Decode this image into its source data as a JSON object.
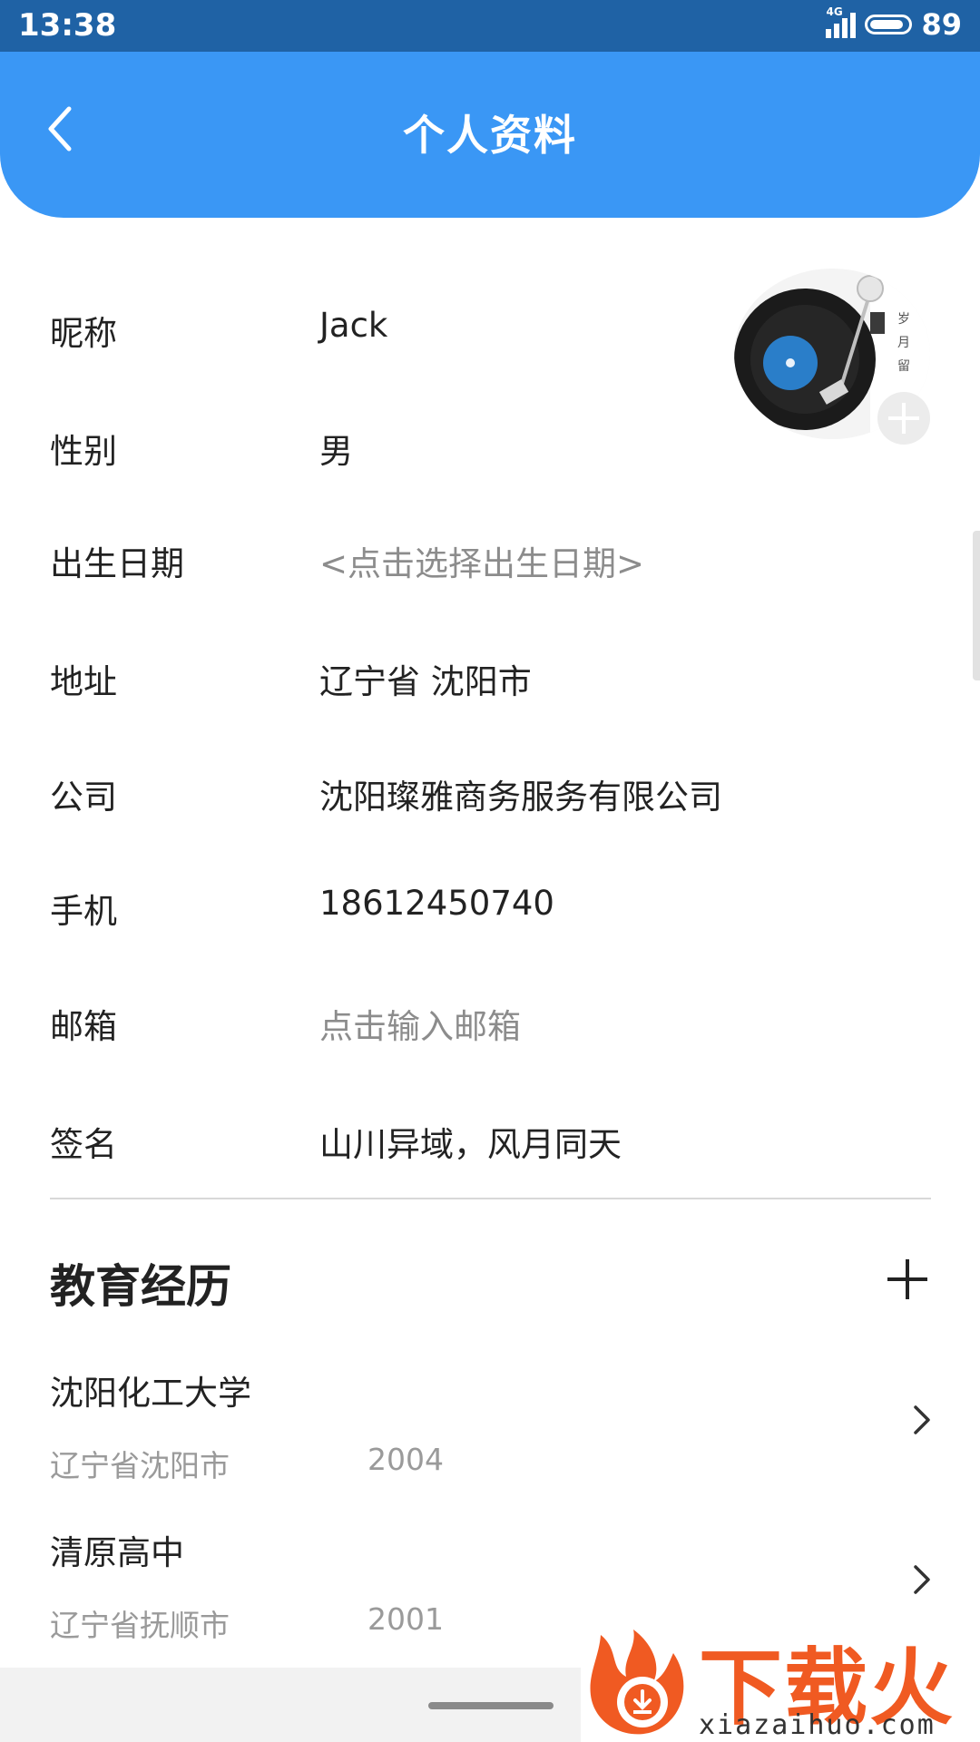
{
  "status_bar": {
    "time": "13:38",
    "network": "4G",
    "battery": "89",
    "battery_level": 0.89
  },
  "header": {
    "title": "个人资料",
    "back_icon": "chevron-left-icon"
  },
  "profile": {
    "rows": [
      {
        "label": "昵称",
        "value": "Jack"
      },
      {
        "label": "性别",
        "value": "男"
      },
      {
        "label": "出生日期",
        "value": "<点击选择出生日期>"
      },
      {
        "label": "地址",
        "value": "辽宁省 沈阳市"
      },
      {
        "label": "公司",
        "value": "沈阳璨雅商务服务有限公司"
      },
      {
        "label": "手机",
        "value": "18612450740"
      },
      {
        "label": "邮箱",
        "value": "点击输入邮箱"
      },
      {
        "label": "签名",
        "value": "山川异域，风月同天"
      }
    ],
    "avatar_icon": "vinyl-record-avatar",
    "avatar_add_icon": "plus-icon"
  },
  "education": {
    "title": "教育经历",
    "add_icon": "plus-icon",
    "items": [
      {
        "school": "沈阳化工大学",
        "place": "辽宁省沈阳市",
        "year": "2004"
      },
      {
        "school": "清原高中",
        "place": "辽宁省抚顺市",
        "year": "2001"
      }
    ]
  },
  "watermark": {
    "text": "下载火",
    "url": "xiazaihuo.com"
  },
  "colors": {
    "status_bar": "#1f62a5",
    "header": "#3a97f5",
    "hint_text": "#8c8c8c",
    "watermark": "#f05a22"
  }
}
